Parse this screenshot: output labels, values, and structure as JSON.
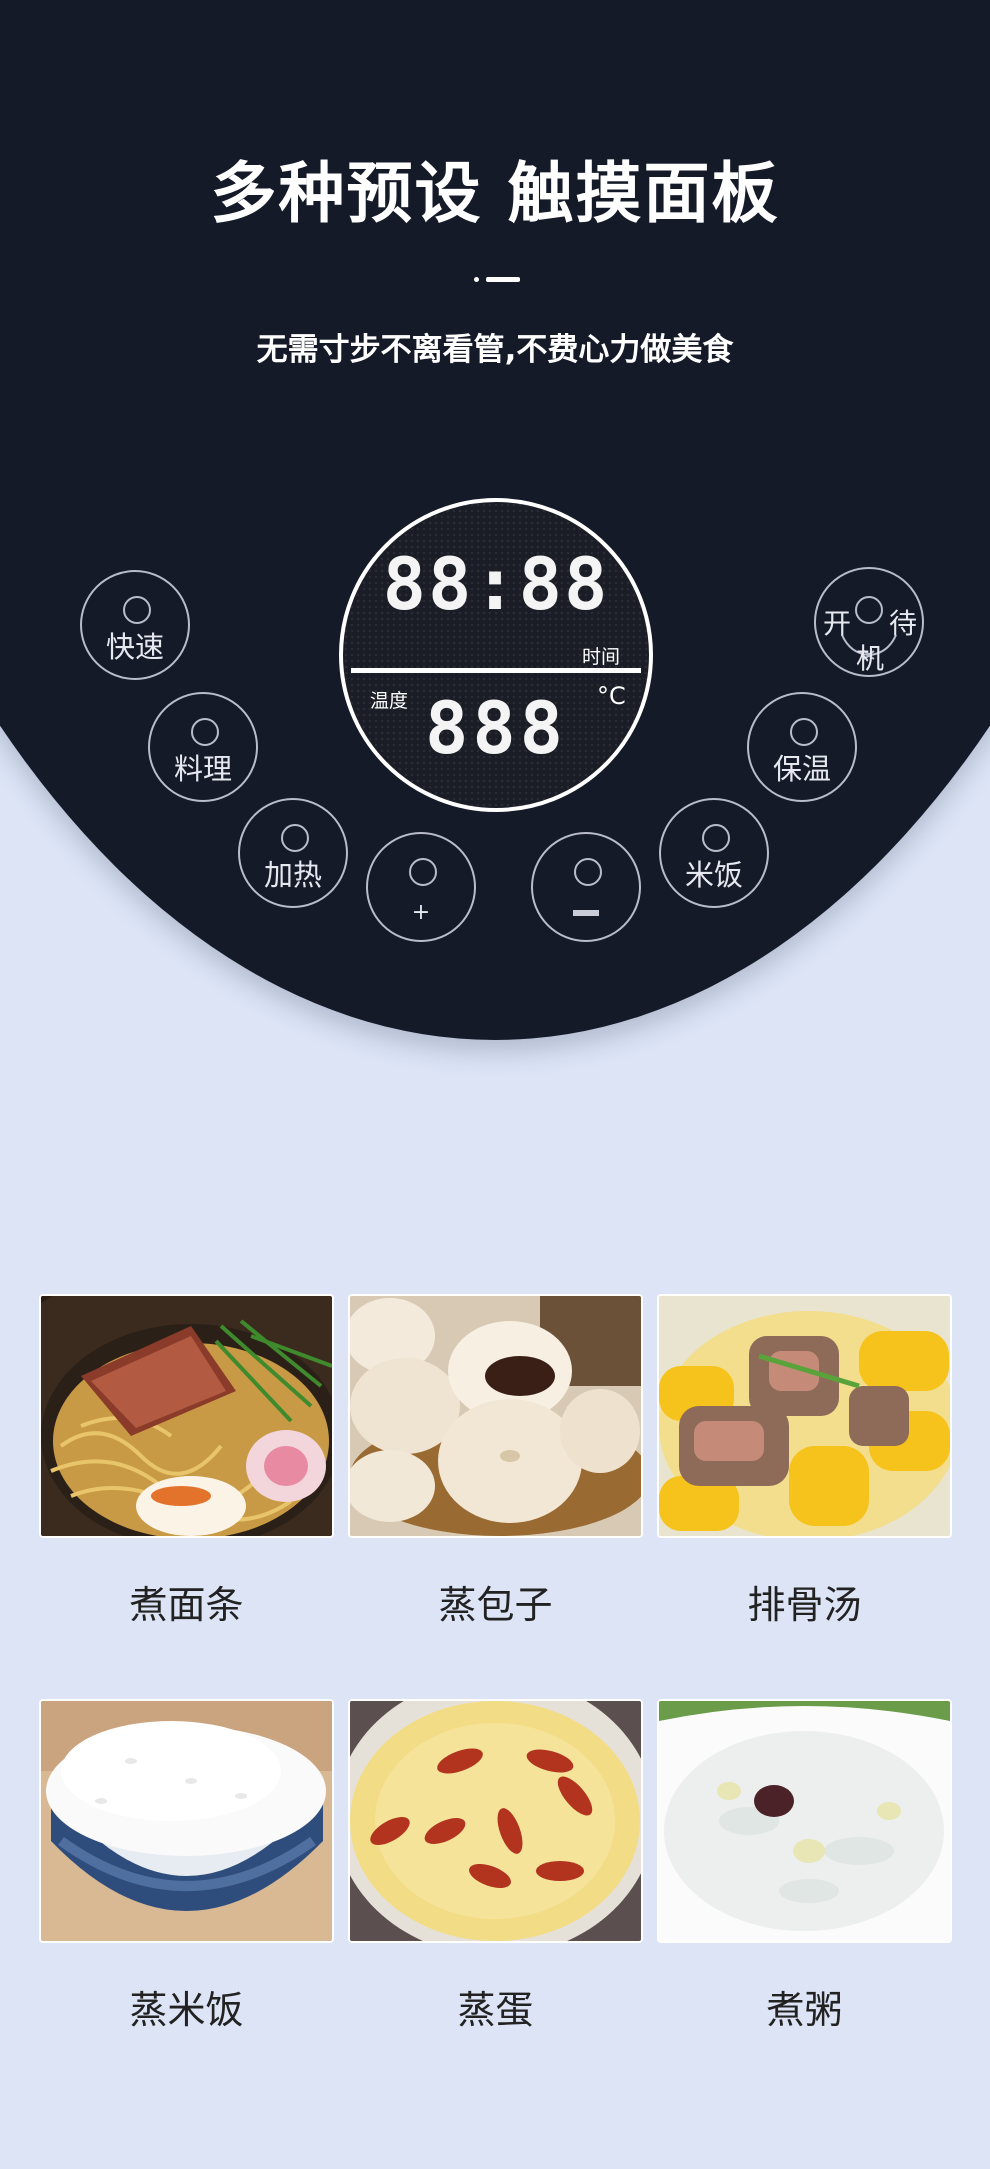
{
  "header": {
    "title": "多种预设 触摸面板",
    "subtitle": "无需寸步不离看管,不费心力做美食"
  },
  "display": {
    "time_value": "88:88",
    "time_label": "时间",
    "temp_label": "温度",
    "temp_value": "888",
    "temp_unit": "°C"
  },
  "buttons": {
    "quick": "快速",
    "cooking": "料理",
    "heat": "加热",
    "plus": "+",
    "minus": "−",
    "rice": "米饭",
    "keep_warm": "保温",
    "power_top_left": "开",
    "power_top_right": "待",
    "power_bottom": "机"
  },
  "foods": [
    {
      "label": "煮面条"
    },
    {
      "label": "蒸包子"
    },
    {
      "label": "排骨汤"
    },
    {
      "label": "蒸米饭"
    },
    {
      "label": "蒸蛋"
    },
    {
      "label": "煮粥"
    }
  ],
  "colors": {
    "panel": "#151a28",
    "background": "#dce4f6",
    "button_outline": "#b9bccb"
  }
}
